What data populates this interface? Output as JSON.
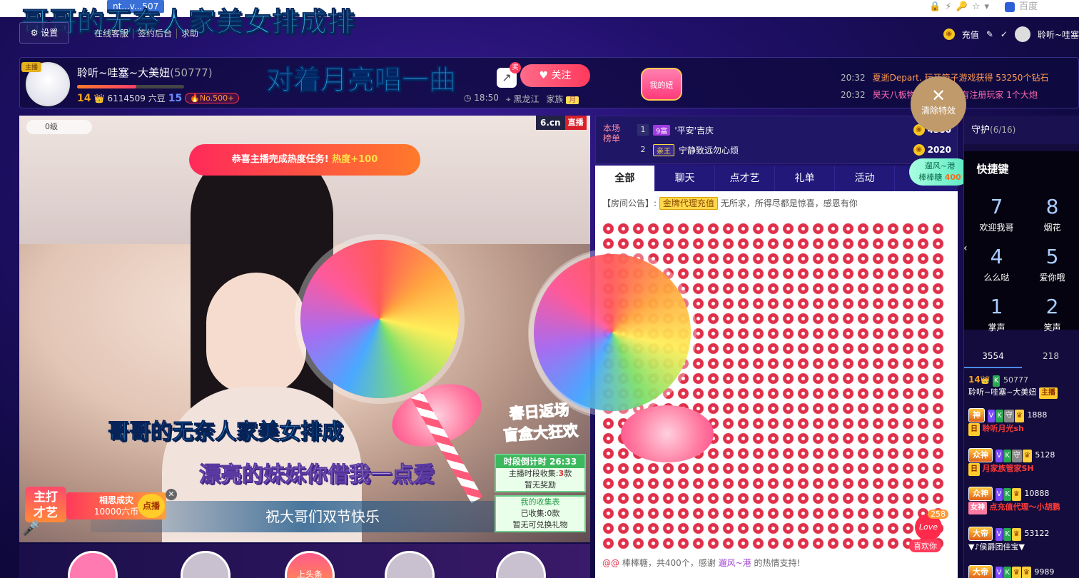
{
  "browser": {
    "url_fragment": "nt...v...507",
    "search_placeholder": "百度"
  },
  "overlay_title": "哥哥的无奈人家美女排成排",
  "topbar": {
    "settings": "设置",
    "menu": [
      "在线客服",
      "签约后台",
      "求助"
    ],
    "recharge": "充值",
    "username": "聆听~哇塞"
  },
  "host": {
    "name": "聆听~哇塞~大美妞",
    "room_id": "(50777)",
    "level": "14",
    "beans": "6114509 六豆",
    "rich_level": "15",
    "rank": "No.500+",
    "time": "18:50",
    "location": "黑龙江",
    "family_label": "家族",
    "family_tag": "月",
    "tag": "主播",
    "progress": 0.55
  },
  "song_title": "对着月亮唱一曲",
  "follow_label": "关注",
  "share_badge": "奖",
  "my_girl": "我的妞",
  "news": [
    {
      "time": "20:32",
      "text": "夏逝Depart. 玩开箱子游戏获得 53250个钻石"
    },
    {
      "time": "20:32",
      "text": "昊天八板物    雪等你来所有注册玩家 1个大炮"
    }
  ],
  "video": {
    "viewer_level": "0级",
    "logo": "6.cn",
    "live_tag": "直播",
    "toast": "恭喜主播完成热度任务!",
    "toast_bonus": "热度+100",
    "lyric1": "哥哥的无奈人家美女排成",
    "lyric2": "漂亮的妹妹你借我一点爱",
    "zhuda": [
      "主打",
      "才艺"
    ],
    "song_card_title": "相思成灾",
    "song_card_price": "10000六币",
    "order_label": "点播",
    "banner": "祝大哥们双节快乐",
    "promo_title": [
      "春日返场",
      "盲盒大狂欢"
    ],
    "countdown": "时段倒计时 26:33",
    "collected_label": "主播时段收集:",
    "collected_count": "3",
    "collected_unit": "款",
    "no_reward": "暂无奖励",
    "my_table": "我的收集表",
    "my_collected_label": "已收集:",
    "my_collected_count": "0",
    "my_collected_unit": "款",
    "no_redeem": "暂无可兑换礼物"
  },
  "bottom_label": "上头条",
  "gift_rank": {
    "label": "本场榜单",
    "rows": [
      {
        "rank": "1",
        "badge": "9富",
        "name": "'平安'吉庆",
        "value": "4380"
      },
      {
        "rank": "2",
        "badge": "亲王",
        "name": "宁静致远勿心烦",
        "value": "2020"
      }
    ]
  },
  "chat": {
    "tabs": [
      "全部",
      "聊天",
      "点才艺",
      "礼单",
      "活动"
    ],
    "active_tab": 0,
    "announce_label": "【房间公告】:",
    "announce_badge": "金牌代理充值",
    "announce_text": "无所求，所得尽都是惊喜，感恩有你",
    "footer_pre": "棒棒糖，共400个，感谢",
    "footer_user": "遛风~港",
    "footer_post": "的热情支持!",
    "love_count": "258",
    "love_text": "Love",
    "like_label": "喜欢你"
  },
  "clear_effect": "清除特效",
  "chase": {
    "name": "遛风~港",
    "gift": "棒棒糖",
    "count": "400"
  },
  "guard": {
    "title": "守护",
    "count": "(6/16)"
  },
  "hotkey": {
    "title": "快捷键",
    "items": [
      {
        "n": "7",
        "label": "欢迎我哥"
      },
      {
        "n": "8",
        "label": "烟花"
      },
      {
        "n": "4",
        "label": "么么哒"
      },
      {
        "n": "5",
        "label": "爱你哦"
      },
      {
        "n": "1",
        "label": "掌声"
      },
      {
        "n": "2",
        "label": "笑声"
      }
    ]
  },
  "viewer_counts": [
    "3554",
    "218"
  ],
  "users": [
    {
      "lvl": "14",
      "id": "50777",
      "name": "聆听~哇塞~大美妞",
      "tag": "主播"
    },
    {
      "tag": "神",
      "name": "聆听月光sh",
      "num": "1888",
      "sub": "日"
    },
    {
      "tag": "众神",
      "name": "月家族管家SH",
      "num": "5128",
      "sub": "日"
    },
    {
      "tag": "众神",
      "name": "点充值代理～小胡鹏",
      "num": "10888",
      "sub": "女神"
    },
    {
      "tag": "大帝",
      "name": "▼♪侯爵团佳宝▼",
      "num": "53122",
      "sub": ""
    },
    {
      "tag": "大帝",
      "name": "",
      "num": "9989",
      "sub": ""
    }
  ]
}
